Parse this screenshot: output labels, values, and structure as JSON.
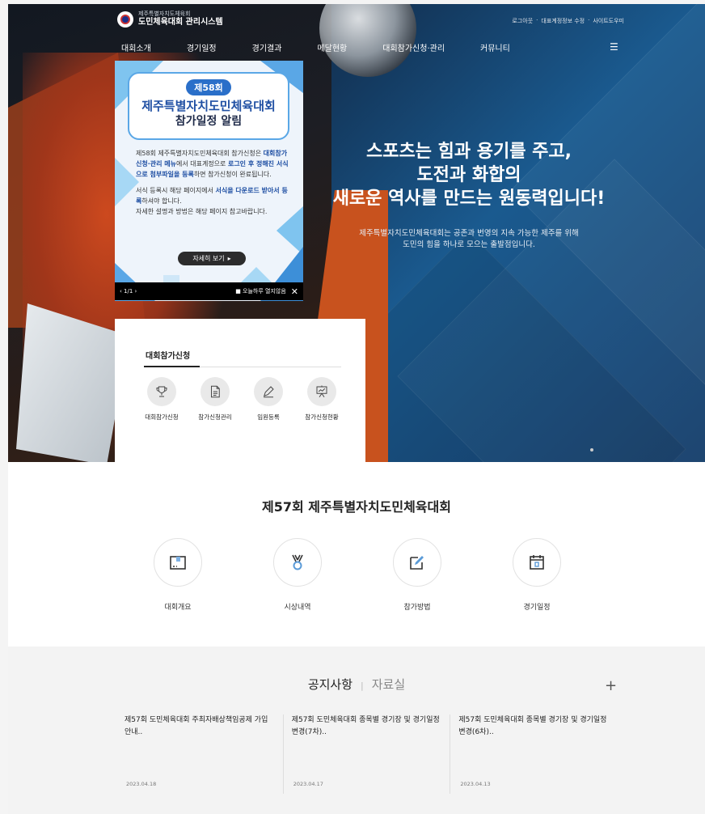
{
  "header": {
    "logo_small": "제주특별자치도체육회",
    "logo_title": "도민체육대회 관리시스템",
    "util_links": [
      "로그아웃",
      "·",
      "대표계정정보 수정",
      "·",
      "사이트도우미"
    ],
    "nav": [
      "대회소개",
      "경기일정",
      "경기결과",
      "메달현황",
      "대회참가신청·관리",
      "커뮤니티"
    ]
  },
  "popup": {
    "badge": "제58회",
    "title": "제주특별자치도민체육대회",
    "subtitle": "참가일정 알림",
    "para1_a": "제58회 제주특별자치도민체육대회 참가신청은 ",
    "para1_b": "대회참가신청·관리 메뉴",
    "para1_c": "에서 대표계정으로 ",
    "para1_d": "로그인 후 정해진 서식으로 첨부파일을 등록",
    "para1_e": "하면 참가신청이 완료됩니다.",
    "para2_a": "서식 등록시 해당 페이지에서 ",
    "para2_b": "서식을 다운로드 받아서 등록",
    "para2_c": "하셔야 합니다.",
    "para3": "자세한 설명과 방법은 해당 페이지 참고바랍니다.",
    "more_button": "자세히 보기",
    "pager": "‹ 1/1 ›",
    "dont_show": "■ 오늘하루 열지않음",
    "close": "✕"
  },
  "hero": {
    "slogan_line1": "스포츠는 힘과 용기를 주고,",
    "slogan_line2": "도전과 화합의",
    "slogan_line3": "새로운 역사를 만드는 원동력입니다!",
    "desc_line1": "제주특별자치도민체육대회는 공존과 번영의 지속 가능한 제주를 위해",
    "desc_line2": "도민의 힘을 하나로 모으는 출발점입니다."
  },
  "apply": {
    "title": "대회참가신청",
    "items": [
      {
        "label": "대회참가신청",
        "icon": "trophy-icon"
      },
      {
        "label": "참가신청관리",
        "icon": "document-icon"
      },
      {
        "label": "임원등록",
        "icon": "pencil-icon"
      },
      {
        "label": "참가신청현황",
        "icon": "presentation-icon"
      }
    ]
  },
  "section57": {
    "title": "제57회 제주특별자치도민체육대회",
    "items": [
      {
        "label": "대회개요",
        "icon": "folder-icon"
      },
      {
        "label": "시상내역",
        "icon": "medal-icon"
      },
      {
        "label": "참가방법",
        "icon": "edit-icon"
      },
      {
        "label": "경기일정",
        "icon": "calendar-icon"
      }
    ]
  },
  "notice": {
    "tab_active": "공지사항",
    "tab_sep": "|",
    "tab_inactive": "자료실",
    "plus": "+",
    "items": [
      {
        "title": "제57회 도민체육대회 주최자배상책임공제 가입 안내..",
        "date": "2023.04.18"
      },
      {
        "title": "제57회 도민체육대회 종목별 경기장 및 경기일정 변경(7차)..",
        "date": "2023.04.17"
      },
      {
        "title": "제57회 도민체육대회 종목별 경기장 및 경기일정 변경(6차)..",
        "date": "2023.04.13"
      }
    ]
  },
  "colors": {
    "accent_blue": "#1f4fa3",
    "hero_blue": "#1a5a8f",
    "orange": "#c8521e"
  }
}
